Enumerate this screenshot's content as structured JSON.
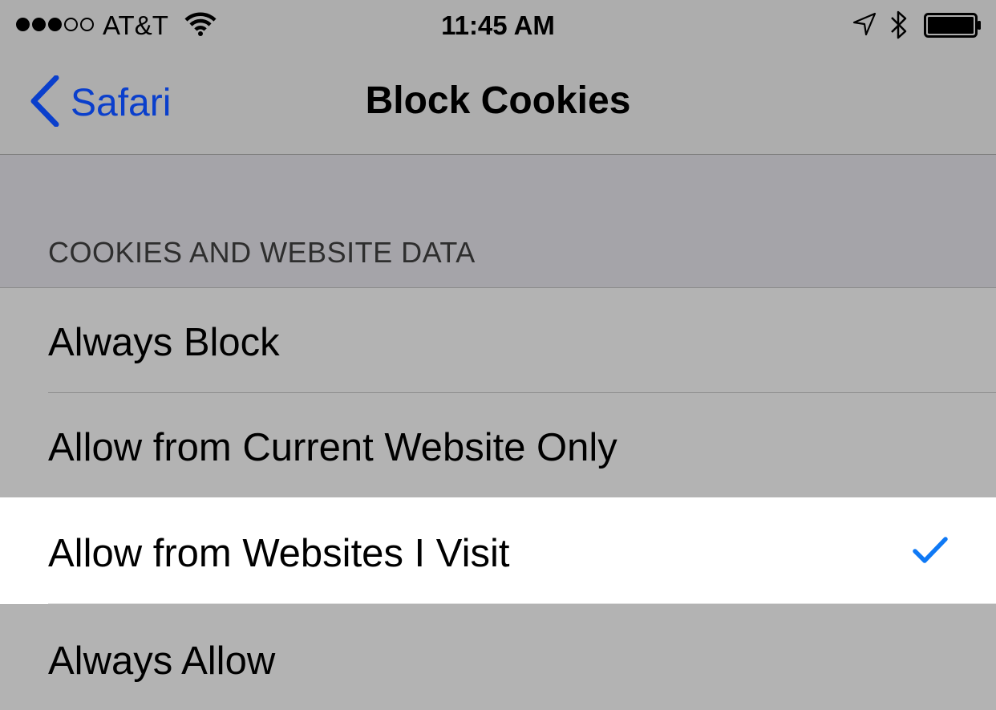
{
  "status_bar": {
    "carrier": "AT&T",
    "time": "11:45 AM",
    "signal_bars_filled": 3,
    "signal_bars_total": 5
  },
  "nav": {
    "back_label": "Safari",
    "title": "Block Cookies"
  },
  "section": {
    "header": "COOKIES AND WEBSITE DATA"
  },
  "options": [
    {
      "label": "Always Block",
      "selected": false
    },
    {
      "label": "Allow from Current Website Only",
      "selected": false
    },
    {
      "label": "Allow from Websites I Visit",
      "selected": true
    },
    {
      "label": "Always Allow",
      "selected": false
    }
  ],
  "colors": {
    "tint": "#0a3fcc",
    "checkmark": "#0f79f5",
    "dimmed_background": "#b3b3b3",
    "selected_background": "#ffffff"
  }
}
